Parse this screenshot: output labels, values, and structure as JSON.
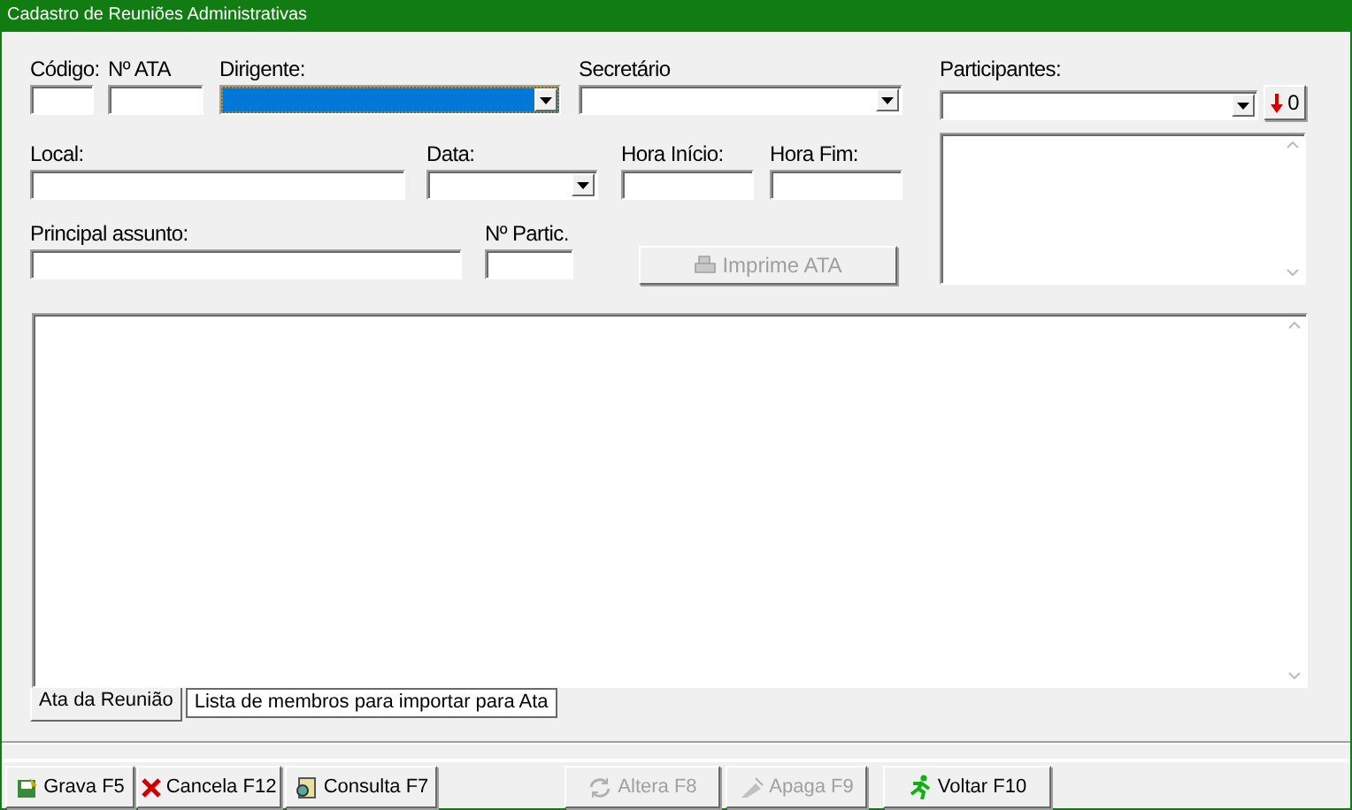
{
  "window": {
    "title": "Cadastro de Reuniões Administrativas"
  },
  "rows": [
    [
      {
        "kind": "text",
        "label": "Código:",
        "focused": false
      },
      {
        "kind": "text",
        "label": "Nº ATA",
        "focused": false
      },
      {
        "kind": "combo",
        "label": "Dirigente:",
        "focused": true
      },
      {
        "kind": "combo",
        "label": "Secretário",
        "focused": false
      }
    ],
    [
      {
        "kind": "text",
        "label": "Local:",
        "focused": false
      },
      {
        "kind": "combo",
        "label": "Data:",
        "focused": false
      },
      {
        "kind": "text",
        "label": "Hora Início:",
        "focused": false
      },
      {
        "kind": "text",
        "label": "Hora Fim:",
        "focused": false
      }
    ],
    [
      {
        "kind": "text",
        "label": "Principal assunto:",
        "focused": false
      },
      {
        "kind": "text",
        "label": "Nº Partic.",
        "focused": false
      }
    ]
  ],
  "print_button": {
    "label": "Imprime ATA",
    "disabled": true
  },
  "participants": {
    "label": "Participantes:",
    "count_button": "0"
  },
  "tabs": [
    {
      "label": "Ata da Reunião",
      "selected": true
    },
    {
      "label": "Lista de membros para importar para Ata",
      "selected": false
    }
  ],
  "toolbar": [
    {
      "label": "Grava F5",
      "disabled": false
    },
    {
      "label": "Cancela F12",
      "disabled": false
    },
    {
      "label": "Consulta F7",
      "disabled": false
    },
    {
      "label": "Altera F8",
      "disabled": true
    },
    {
      "label": "Apaga F9",
      "disabled": true
    },
    {
      "label": "Voltar F10",
      "disabled": false
    }
  ]
}
